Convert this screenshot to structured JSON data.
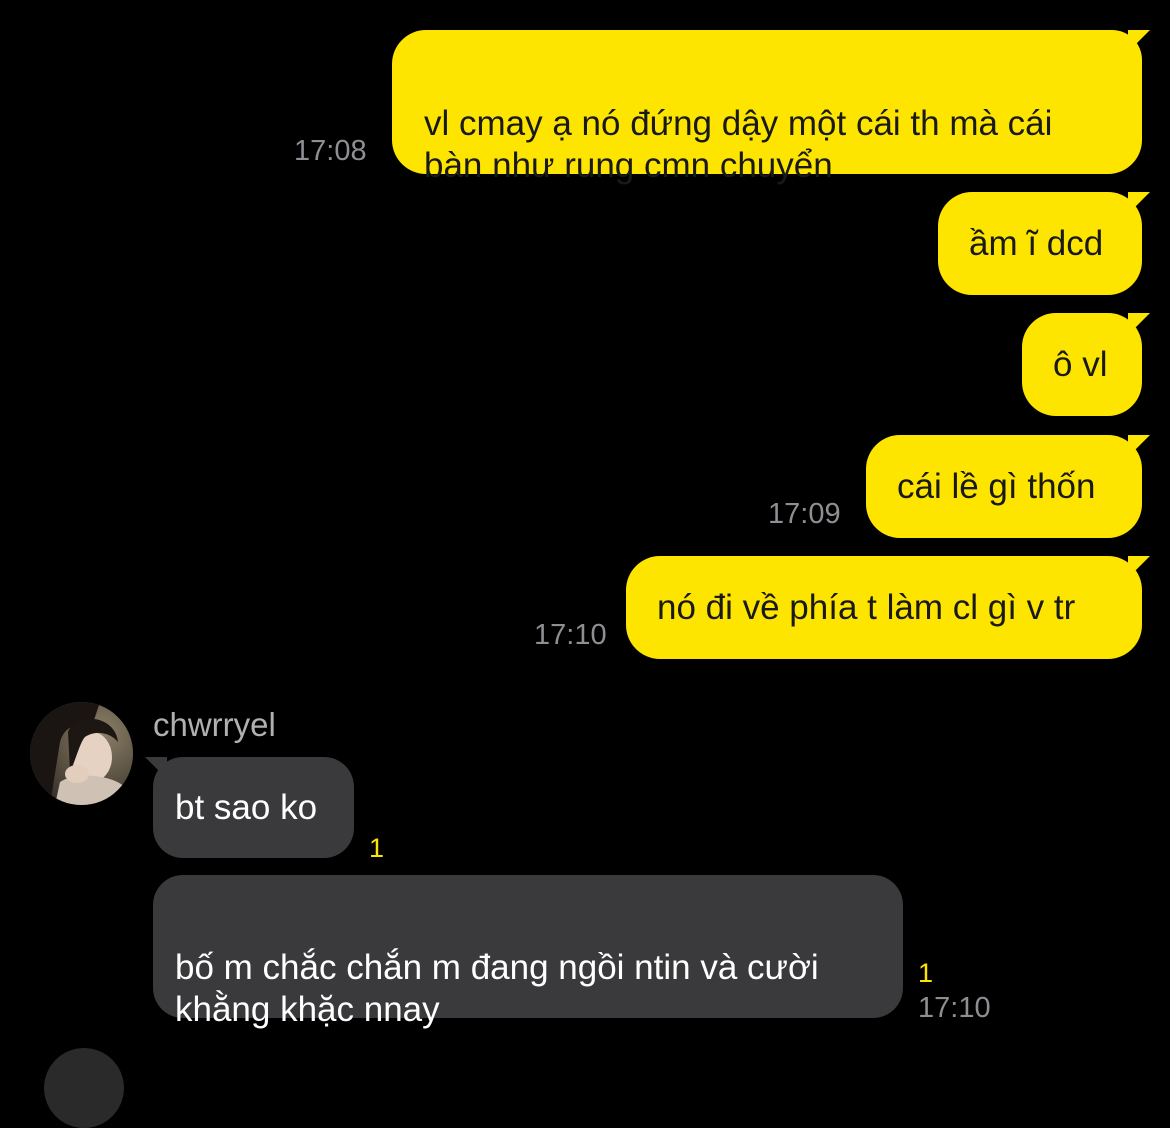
{
  "chat": {
    "outgoing": [
      {
        "text": "vl cmay ạ nó đứng dậy một cái th mà cái\nbàn như rung cmn chuyển",
        "time": "17:08"
      },
      {
        "text": "ầm ĩ dcd",
        "time": ""
      },
      {
        "text": "ô vl",
        "time": ""
      },
      {
        "text": "cái lề gì thốn",
        "time": "17:09"
      },
      {
        "text": "nó đi về phía t làm cl gì v tr",
        "time": "17:10"
      }
    ],
    "incoming": {
      "sender_name": "chwrryel",
      "messages": [
        {
          "text": "bt sao ko",
          "unread": "1",
          "time": ""
        },
        {
          "text": "bố m chắc chắn m đang ngồi ntin và cười\nkhằng khặc nnay",
          "unread": "1",
          "time": "17:10"
        }
      ]
    }
  },
  "colors": {
    "background": "#000000",
    "outgoing_bubble": "#FEE500",
    "incoming_bubble": "#3A3A3C",
    "timestamp": "#8E8E93",
    "unread_count": "#FEE500"
  },
  "icons": {
    "sender_avatar": "profile-photo"
  }
}
